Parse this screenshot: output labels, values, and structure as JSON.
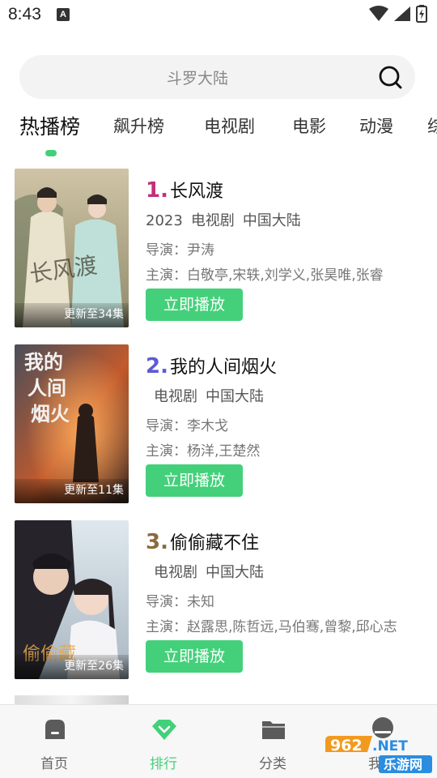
{
  "status_bar": {
    "time": "8:43",
    "notification_icon": "A"
  },
  "search": {
    "placeholder": "斗罗大陆"
  },
  "tabs": [
    {
      "label": "热播榜",
      "active": true
    },
    {
      "label": "飙升榜"
    },
    {
      "label": "电视剧"
    },
    {
      "label": "电影"
    },
    {
      "label": "动漫"
    },
    {
      "label": "综"
    }
  ],
  "items": [
    {
      "rank": "1.",
      "rank_color": "#c2307a",
      "title": "长风渡",
      "year": "2023",
      "genre": "电视剧",
      "region": "中国大陆",
      "director": "导演：尹涛",
      "cast": "主演：白敬亭,宋轶,刘学义,张昊唯,张睿",
      "update": "更新至34集",
      "play_label": "立即播放"
    },
    {
      "rank": "2.",
      "rank_color": "#5b5bd6",
      "title": "我的人间烟火",
      "year": "",
      "genre": "电视剧",
      "region": "中国大陆",
      "director": "导演：李木戈",
      "cast": "主演：杨洋,王楚然",
      "update": "更新至11集",
      "play_label": "立即播放"
    },
    {
      "rank": "3.",
      "rank_color": "#8a6a3e",
      "title": "偷偷藏不住",
      "year": "",
      "genre": "电视剧",
      "region": "中国大陆",
      "director": "导演：未知",
      "cast": "主演：赵露思,陈哲远,马伯骞,曾黎,邱心志",
      "update": "更新至26集",
      "play_label": "立即播放"
    }
  ],
  "bottom_nav": [
    {
      "label": "首页",
      "icon": "home-icon"
    },
    {
      "label": "排行",
      "icon": "ranking-icon",
      "active": true
    },
    {
      "label": "分类",
      "icon": "folder-icon"
    },
    {
      "label": "我的",
      "icon": "profile-icon"
    }
  ],
  "watermark": {
    "number": "962",
    "suffix": ".NET",
    "text": "乐游网"
  },
  "colors": {
    "accent": "#44d07a"
  }
}
